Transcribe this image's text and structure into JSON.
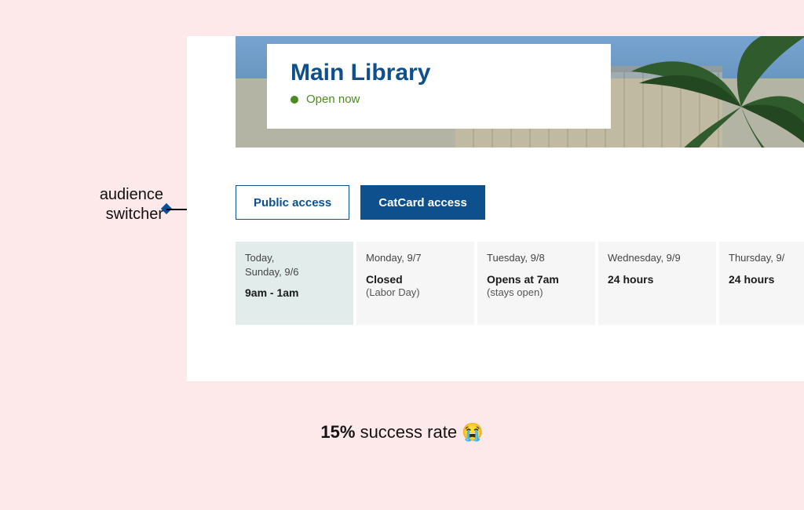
{
  "library": {
    "title": "Main Library",
    "status_text": "Open now"
  },
  "annotation": {
    "line1": "audience",
    "line2": "switcher"
  },
  "switcher": {
    "public_label": "Public access",
    "catcard_label": "CatCard access"
  },
  "days": [
    {
      "label_line1": "Today,",
      "label_line2": "Sunday, 9/6",
      "hours": "9am - 1am",
      "note": "",
      "today": true
    },
    {
      "label_line1": "Monday, 9/7",
      "label_line2": "",
      "hours": "Closed",
      "note": "(Labor Day)",
      "today": false
    },
    {
      "label_line1": "Tuesday, 9/8",
      "label_line2": "",
      "hours": "Opens at 7am",
      "note": "(stays open)",
      "today": false
    },
    {
      "label_line1": "Wednesday, 9/9",
      "label_line2": "",
      "hours": "24 hours",
      "note": "",
      "today": false
    },
    {
      "label_line1": "Thursday, 9/",
      "label_line2": "",
      "hours": "24 hours",
      "note": "",
      "today": false
    }
  ],
  "caption": {
    "bold": "15%",
    "rest": " success rate ",
    "emoji": "😭"
  }
}
